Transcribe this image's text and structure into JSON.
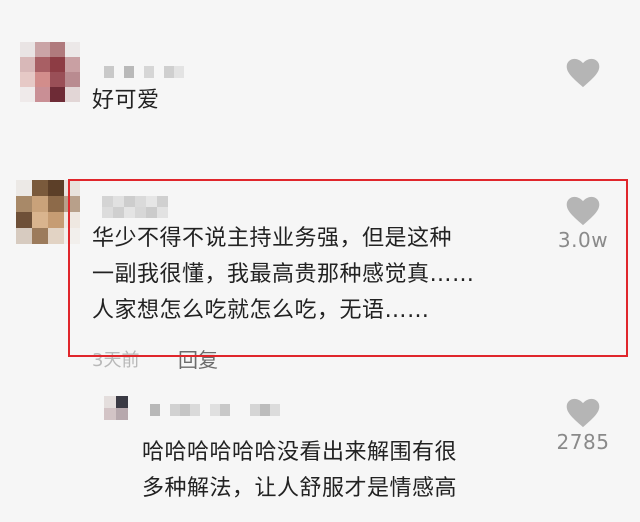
{
  "colors": {
    "background": "#f6f6f6",
    "highlight_border": "#e0262b",
    "like_icon": "#b5b5b5"
  },
  "comments": [
    {
      "text": "好可爱",
      "like_icon": "heart-icon"
    },
    {
      "lines": [
        "华少不得不说主持业务强，但是这种",
        "一副我很懂，我最高贵那种感觉真……",
        "人家想怎么吃就怎么吃，无语……"
      ],
      "time": "3天前",
      "reply_label": "回复",
      "likes": "3.0w",
      "like_icon": "heart-icon"
    }
  ],
  "replies": [
    {
      "lines": [
        "哈哈哈哈哈哈没看出来解围有很",
        "多种解法，让人舒服才是情感高"
      ],
      "likes": "2785",
      "like_icon": "heart-icon"
    }
  ]
}
